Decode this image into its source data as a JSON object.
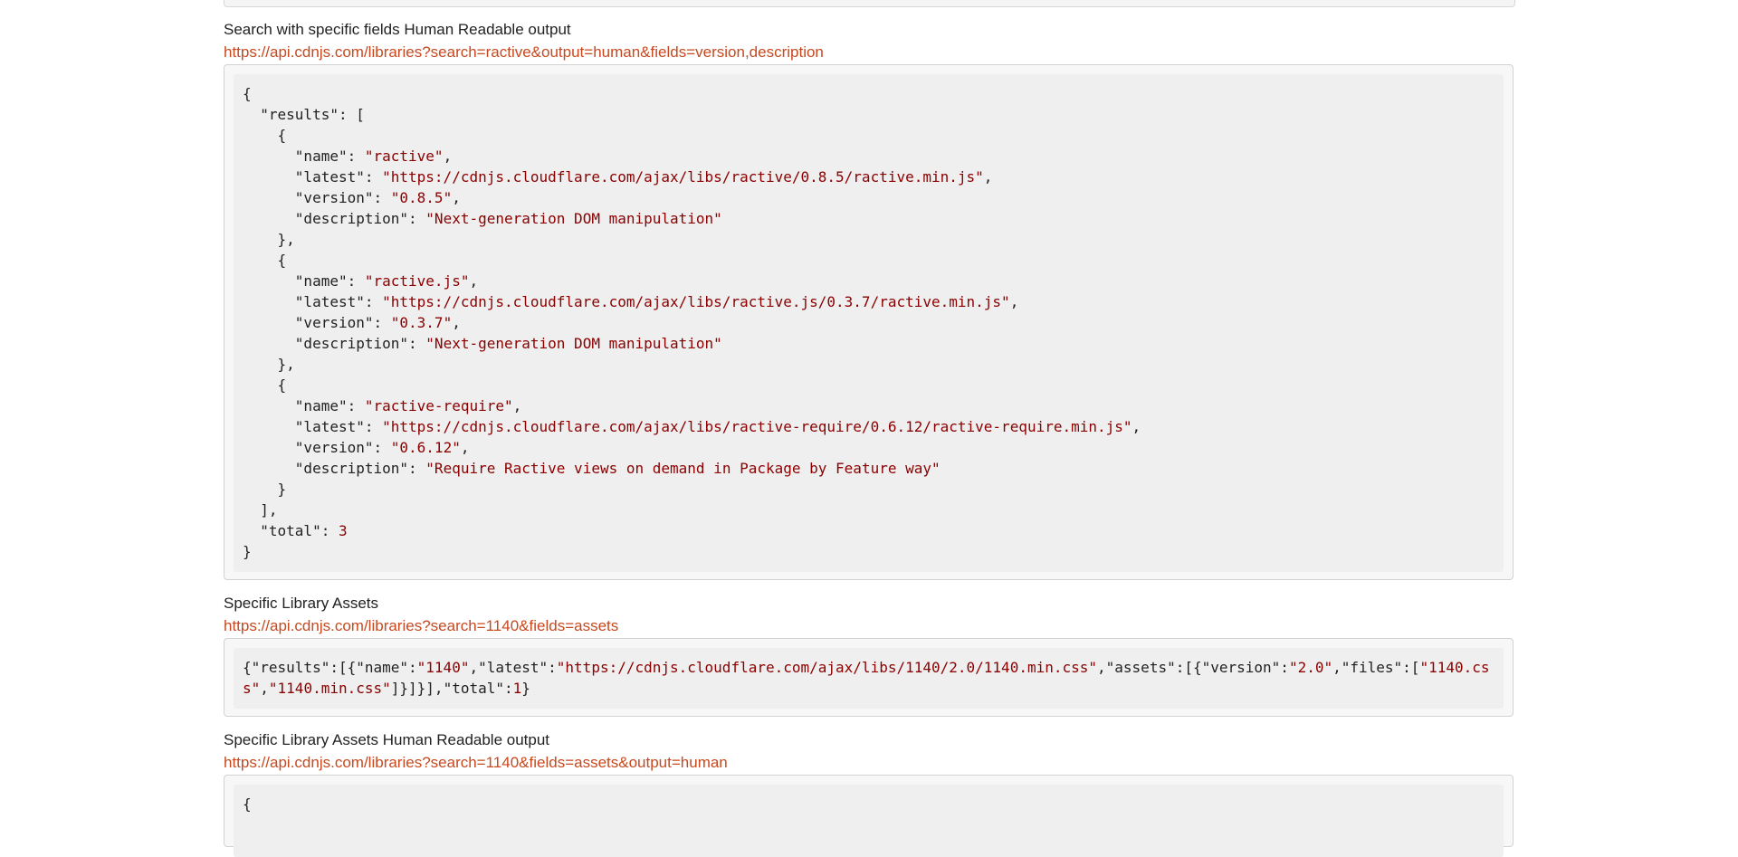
{
  "sections": [
    {
      "title": "Search with specific fields Human Readable output",
      "link": "https://api.cdnjs.com/libraries?search=ractive&output=human&fields=version,description",
      "json_lines": [
        "{",
        "  \"results\": [",
        "    {",
        "      \"name\": \"ractive\",",
        "      \"latest\": \"https://cdnjs.cloudflare.com/ajax/libs/ractive/0.8.5/ractive.min.js\",",
        "      \"version\": \"0.8.5\",",
        "      \"description\": \"Next-generation DOM manipulation\"",
        "    },",
        "    {",
        "      \"name\": \"ractive.js\",",
        "      \"latest\": \"https://cdnjs.cloudflare.com/ajax/libs/ractive.js/0.3.7/ractive.min.js\",",
        "      \"version\": \"0.3.7\",",
        "      \"description\": \"Next-generation DOM manipulation\"",
        "    },",
        "    {",
        "      \"name\": \"ractive-require\",",
        "      \"latest\": \"https://cdnjs.cloudflare.com/ajax/libs/ractive-require/0.6.12/ractive-require.min.js\",",
        "      \"version\": \"0.6.12\",",
        "      \"description\": \"Require Ractive views on demand in Package by Feature way\"",
        "    }",
        "  ],",
        "  \"total\": 3",
        "}"
      ]
    },
    {
      "title": "Specific Library Assets",
      "link": "https://api.cdnjs.com/libraries?search=1140&fields=assets",
      "json_text": "{\"results\":[{\"name\":\"1140\",\"latest\":\"https://cdnjs.cloudflare.com/ajax/libs/1140/2.0/1140.min.css\",\"assets\":[{\"version\":\"2.0\",\"files\":[\"1140.css\",\"1140.min.css\"]}]}],\"total\":1}"
    },
    {
      "title": "Specific Library Assets Human Readable output",
      "link": "https://api.cdnjs.com/libraries?search=1140&fields=assets&output=human",
      "json_lines": [
        "{"
      ]
    }
  ],
  "colors": {
    "link": "#c7491f",
    "string": "#8b0000",
    "code_bg": "#efefef",
    "box_border": "#d2d2d2"
  }
}
